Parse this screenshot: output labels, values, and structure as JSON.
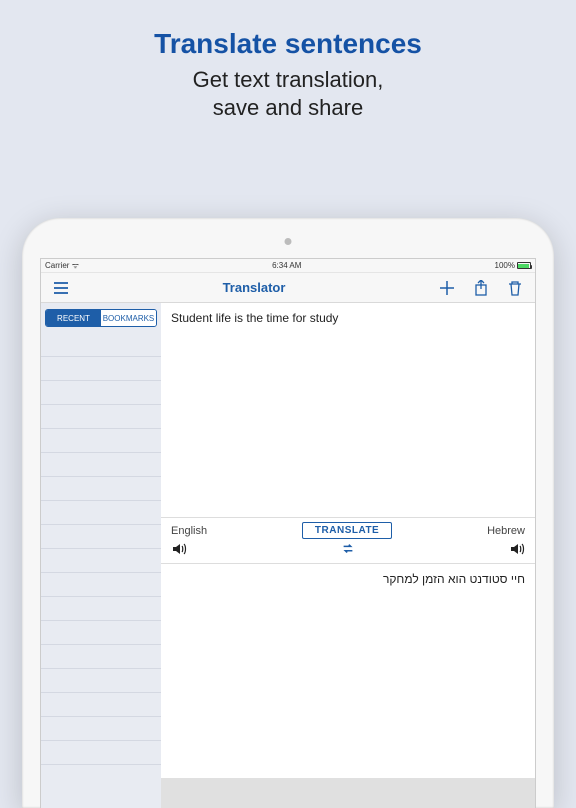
{
  "promo": {
    "title": "Translate sentences",
    "sub1": "Get text translation,",
    "sub2": "save and share"
  },
  "status": {
    "carrier": "Carrier",
    "time": "6:34 AM",
    "battery": "100%"
  },
  "nav": {
    "title": "Translator"
  },
  "tabs": {
    "recent": "RECENT",
    "bookmarks": "BOOKMARKS"
  },
  "translation": {
    "source_text": "Student life is the time for study",
    "source_lang": "English",
    "target_lang": "Hebrew",
    "button": "TRANSLATE",
    "target_text": "חיי סטודנט הוא הזמן למחקר"
  }
}
